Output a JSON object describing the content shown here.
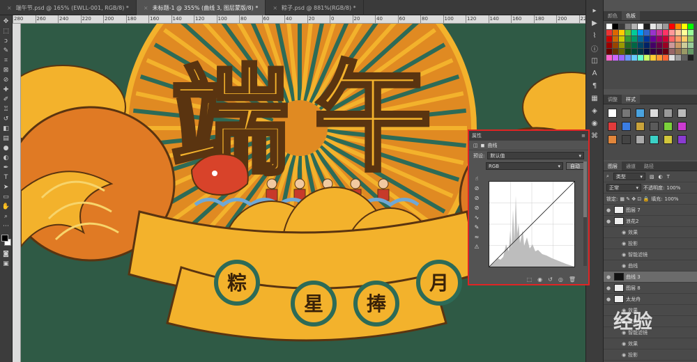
{
  "tabs": [
    {
      "label": "端午节.psd @ 165% (EWLL-001, RGB/8) *",
      "active": false
    },
    {
      "label": "未标题-1 @ 355% (曲线 3, 图层蒙版/8) *",
      "active": true
    },
    {
      "label": "粽子.psd @ 881%(RGB/8) *",
      "active": false
    }
  ],
  "ruler_ticks": [
    "280",
    "260",
    "240",
    "220",
    "200",
    "180",
    "160",
    "140",
    "120",
    "100",
    "80",
    "60",
    "40",
    "20",
    "0",
    "20",
    "40",
    "60",
    "80",
    "100",
    "120",
    "140",
    "160",
    "180",
    "200",
    "220",
    "240",
    "260",
    "280"
  ],
  "artwork": {
    "title_chars": [
      "端",
      "午"
    ],
    "badges": [
      "粽",
      "星",
      "捧",
      "月"
    ],
    "colors": {
      "bg": "#2f5a45",
      "gold": "#f3b22c",
      "orange": "#e8892a",
      "teal": "#2d6b57",
      "brown": "#5a3410"
    }
  },
  "swatches_panel": {
    "tabs": [
      "颜色",
      "色板"
    ],
    "active": "色板",
    "colors": [
      "#ffffff",
      "#000000",
      "#3a3a3a",
      "#7d7d7d",
      "#b3b3b3",
      "#ffffff",
      "#1d1d1d",
      "#e5e5e5",
      "#c4c4c4",
      "#9a9a9a",
      "#ff0000",
      "#ff8800",
      "#ffff00",
      "#00ff00",
      "#ee3333",
      "#dd6600",
      "#ffcc00",
      "#66cc33",
      "#00cc99",
      "#0099ff",
      "#3366cc",
      "#9933cc",
      "#cc3399",
      "#ff3366",
      "#ff9999",
      "#ffcc99",
      "#ffff99",
      "#99ff99",
      "#cc0000",
      "#cc6600",
      "#cccc00",
      "#339933",
      "#009966",
      "#006699",
      "#003399",
      "#660099",
      "#990066",
      "#cc0033",
      "#ff6666",
      "#ff9966",
      "#ffcc66",
      "#99cc66",
      "#990000",
      "#994400",
      "#999900",
      "#226622",
      "#006644",
      "#004466",
      "#002266",
      "#440066",
      "#660044",
      "#990022",
      "#cc9999",
      "#cc9966",
      "#cccc99",
      "#99cc99",
      "#660000",
      "#663300",
      "#666600",
      "#114411",
      "#004433",
      "#003344",
      "#001144",
      "#330044",
      "#440033",
      "#660011",
      "#996666",
      "#997755",
      "#999966",
      "#669966",
      "#ff66cc",
      "#cc66ff",
      "#9966ff",
      "#6699ff",
      "#66ccff",
      "#66ffcc",
      "#ccff66",
      "#ffcc33",
      "#ff9933",
      "#ff6633",
      "#e0e0e0",
      "#a0a0a0",
      "#606060",
      "#202020"
    ]
  },
  "styles_panel": {
    "tabs": [
      "调整",
      "样式"
    ],
    "active": "样式",
    "items": [
      "#ffffff",
      "#777777",
      "#4aa3df",
      "#dddddd",
      "#9a9a9a",
      "#bbbbbb",
      "#e23b3b",
      "#3b7de2",
      "#c9a33b",
      "#5a5a5a",
      "#7bd13b",
      "#cc3bd1",
      "#e2863b",
      "#444444",
      "#aaaaaa",
      "#3bd1c6",
      "#d1c63b",
      "#8a3bd1"
    ]
  },
  "layers_panel": {
    "tabs": [
      "图层",
      "通道",
      "路径"
    ],
    "active": "图层",
    "filter_label": "类型",
    "blend_mode": "正常",
    "opacity_label": "不透明度:",
    "opacity": "100%",
    "lock_label": "锁定:",
    "fill_label": "填充:",
    "fill": "100%",
    "layers": [
      {
        "name": "图层 7",
        "type": "layer",
        "selected": false
      },
      {
        "name": "浪花2",
        "type": "layer",
        "selected": false
      },
      {
        "name": "效果",
        "type": "sub",
        "selected": false
      },
      {
        "name": "投影",
        "type": "sub",
        "selected": false
      },
      {
        "name": "智能滤镜",
        "type": "sub",
        "selected": false
      },
      {
        "name": "曲线",
        "type": "sub",
        "selected": false
      },
      {
        "name": "曲线 3",
        "type": "adjust",
        "selected": true
      },
      {
        "name": "图层 8",
        "type": "layer",
        "selected": false
      },
      {
        "name": "太龙舟",
        "type": "layer",
        "selected": false
      },
      {
        "name": "效果",
        "type": "sub",
        "selected": false
      },
      {
        "name": "投影",
        "type": "sub",
        "selected": false
      },
      {
        "name": "智能滤镜",
        "type": "sub",
        "selected": false
      },
      {
        "name": "效果",
        "type": "sub",
        "selected": false
      },
      {
        "name": "投影",
        "type": "sub",
        "selected": false
      }
    ]
  },
  "properties": {
    "title": "属性",
    "subtitle": "曲线",
    "preset_label": "预设:",
    "preset_value": "默认值",
    "channel": "RGB",
    "auto_label": "自动"
  },
  "watermark": "经验"
}
